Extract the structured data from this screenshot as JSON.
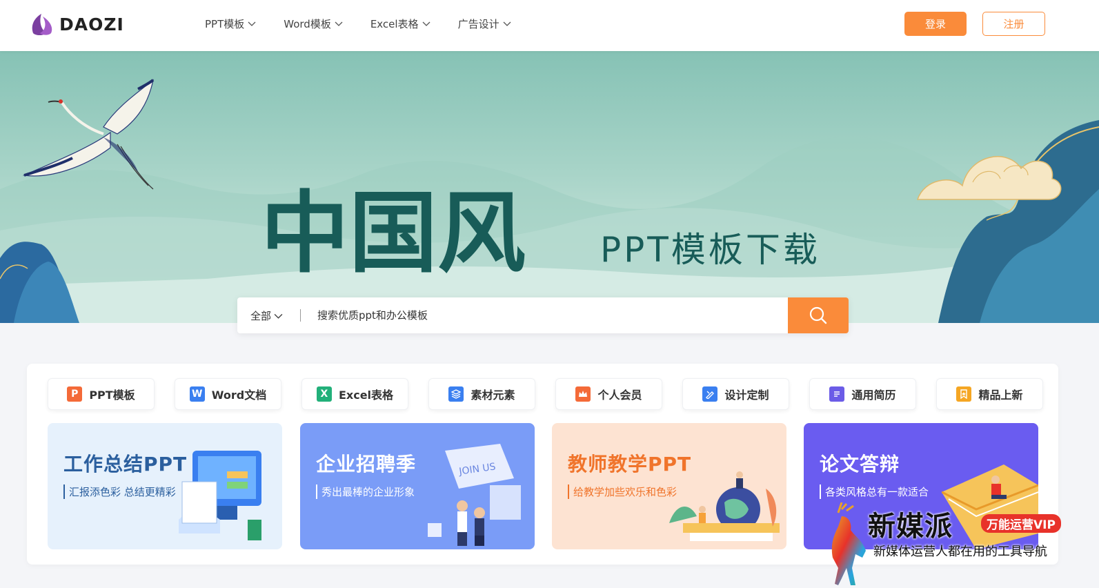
{
  "header": {
    "logo_text": "DAOZI",
    "nav": [
      {
        "label": "PPT模板"
      },
      {
        "label": "Word模板"
      },
      {
        "label": "Excel表格"
      },
      {
        "label": "广告设计"
      }
    ],
    "login_label": "登录",
    "register_label": "注册"
  },
  "banner": {
    "title": "中国风",
    "subtitle": "PPT模板下载"
  },
  "search": {
    "category": "全部",
    "placeholder": "搜索优质ppt和办公模板"
  },
  "categories": [
    {
      "label": "PPT模板",
      "icon": "ppt-icon",
      "icon_char": "P",
      "color": "#f46a38"
    },
    {
      "label": "Word文档",
      "icon": "word-icon",
      "icon_char": "W",
      "color": "#3a7ff0"
    },
    {
      "label": "Excel表格",
      "icon": "excel-icon",
      "icon_char": "X",
      "color": "#22b07a"
    },
    {
      "label": "素材元素",
      "icon": "layers-icon",
      "icon_char": "",
      "color": "#3a7ff0"
    },
    {
      "label": "个人会员",
      "icon": "crown-icon",
      "icon_char": "",
      "color": "#f46a38"
    },
    {
      "label": "设计定制",
      "icon": "design-icon",
      "icon_char": "",
      "color": "#3a7ff0"
    },
    {
      "label": "通用简历",
      "icon": "resume-icon",
      "icon_char": "",
      "color": "#6b5ce7"
    },
    {
      "label": "精品上新",
      "icon": "bookmark-icon",
      "icon_char": "",
      "color": "#f5a623"
    }
  ],
  "cards": [
    {
      "title": "工作总结PPT",
      "subtitle": "汇报添色彩 总结更精彩",
      "bg": "#e6f1fc",
      "title_color": "#2b5f9e",
      "sub_color": "#2b5f9e"
    },
    {
      "title": "企业招聘季",
      "subtitle": "秀出最棒的企业形象",
      "bg": "#7a9cf7",
      "title_color": "#ffffff",
      "sub_color": "#ffffff"
    },
    {
      "title": "教师教学PPT",
      "subtitle": "给教学加些欢乐和色彩",
      "bg": "#fde3d2",
      "title_color": "#f0742b",
      "sub_color": "#f0742b"
    },
    {
      "title": "论文答辩",
      "subtitle": "各类风格总有一款适合",
      "bg": "#6a5cf0",
      "title_color": "#ffffff",
      "sub_color": "#ffffff"
    }
  ],
  "watermark": {
    "title": "新媒派",
    "badge": "万能运营VIP",
    "subtitle": "新媒体运营人都在用的工具导航"
  },
  "colors": {
    "accent": "#fa8b3a",
    "banner_title": "#185c58"
  }
}
